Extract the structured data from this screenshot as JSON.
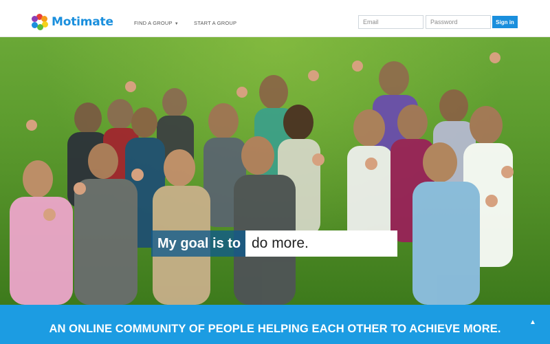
{
  "header": {
    "brand": "Motimate",
    "nav": {
      "find_group": "FIND A GROUP",
      "start_group": "START A GROUP"
    },
    "login": {
      "email_placeholder": "Email",
      "password_placeholder": "Password",
      "signin_label": "Sign in"
    }
  },
  "hero": {
    "goal_prefix": "My goal is to",
    "goal_value": "do more."
  },
  "banner": {
    "tagline": "AN ONLINE COMMUNITY OF PEOPLE HELPING EACH OTHER TO ACHIEVE MORE."
  },
  "colors": {
    "brand_blue": "#1c9ce2",
    "signin_blue": "#1a8fdd",
    "logo_text": "#1a8fdd",
    "grass": "#5e9d2f"
  },
  "icons": {
    "logo_mark": "circle-of-dots-icon",
    "caret": "chevron-down-icon",
    "scroll_up": "chevron-up-icon"
  }
}
